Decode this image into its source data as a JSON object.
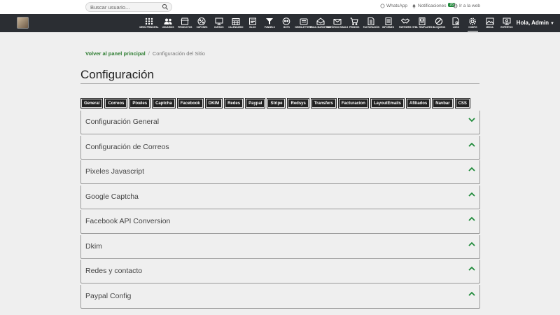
{
  "topbar": {
    "search_placeholder": "Buscar usuario...",
    "whatsapp": "WhatsApp",
    "notifications": "Notificaciones",
    "notifications_count": "26",
    "go_to_web": "Ir a la web"
  },
  "nav": {
    "items": [
      {
        "label": "Menú principal",
        "icon": "grid-icon"
      },
      {
        "label": "Usuarios",
        "icon": "users-icon"
      },
      {
        "label": "Productos",
        "icon": "store-icon"
      },
      {
        "label": "Cupones",
        "icon": "percent-icon"
      },
      {
        "label": "Cursos",
        "icon": "monitor-icon"
      },
      {
        "label": "Calendario",
        "icon": "calendar-icon"
      },
      {
        "label": "Blog",
        "icon": "blog-icon"
      },
      {
        "label": "Funnels",
        "icon": "funnel-icon"
      },
      {
        "label": "Bots",
        "icon": "bot-icon"
      },
      {
        "label": "Newsletters",
        "icon": "newsletter-icon"
      },
      {
        "label": "Email marketing",
        "icon": "email-marketing-icon"
      },
      {
        "label": "Histórico emails",
        "icon": "envelope-icon"
      },
      {
        "label": "Pedidos",
        "icon": "cart-icon"
      },
      {
        "label": "Facturación",
        "icon": "invoice-icon"
      },
      {
        "label": "Informes",
        "icon": "report-icon"
      },
      {
        "label": "Partners",
        "icon": "handshake-icon"
      },
      {
        "label": "HTML Templates",
        "icon": "template-icon"
      },
      {
        "label": "Bloqueos",
        "icon": "block-icon"
      },
      {
        "label": "Logs",
        "icon": "log-icon"
      },
      {
        "label": "Config",
        "icon": "gear-icon",
        "active": true
      },
      {
        "label": "Media",
        "icon": "image-icon"
      },
      {
        "label": "Expertos",
        "icon": "experts-icon"
      }
    ],
    "user_greeting": "Hola, Admin"
  },
  "breadcrumb": {
    "back": "Volver al panel principal",
    "current": "Configuración del Sitio"
  },
  "page_title": "Configuración",
  "tab_buttons": [
    "General",
    "Correos",
    "Pixeles",
    "Captcha",
    "Facebook",
    "DKIM",
    "Redes",
    "Paypal",
    "Stripe",
    "Redsys",
    "Transfers",
    "Facturacion",
    "LayoutEmails",
    "Afiliados",
    "Navbar",
    "CSS"
  ],
  "sections": [
    {
      "title": "Configuración General",
      "chevron": "down"
    },
    {
      "title": "Configuración de Correos",
      "chevron": "up"
    },
    {
      "title": "Pixeles Javascript",
      "chevron": "up"
    },
    {
      "title": "Google Captcha",
      "chevron": "up"
    },
    {
      "title": "Facebook API Conversion",
      "chevron": "up"
    },
    {
      "title": "Dkim",
      "chevron": "up"
    },
    {
      "title": "Redes y contacto",
      "chevron": "up"
    },
    {
      "title": "Paypal Config",
      "chevron": "up"
    }
  ],
  "colors": {
    "accent": "#1f8a3a",
    "navbar": "#2b2e33",
    "link": "#2e7d32"
  }
}
